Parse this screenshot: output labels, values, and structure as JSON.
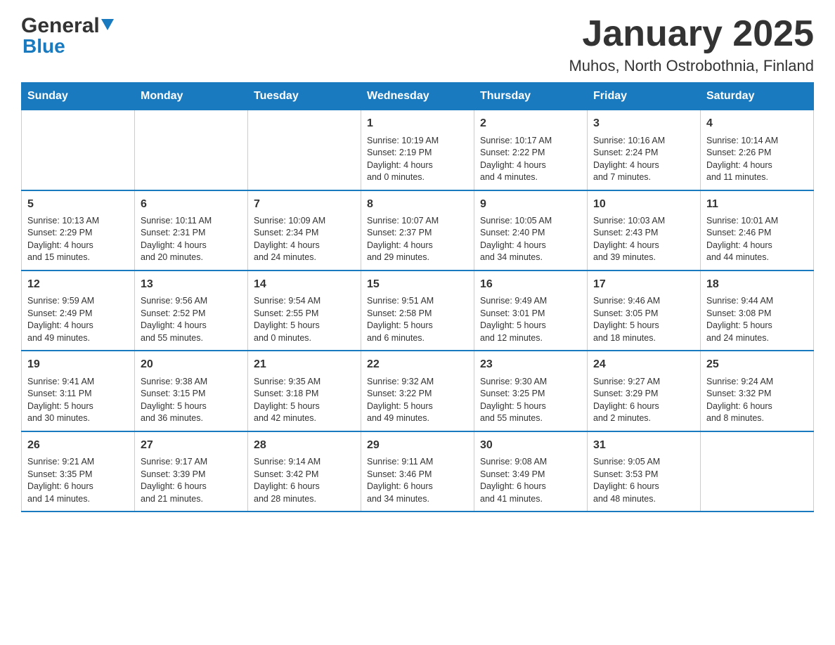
{
  "header": {
    "logo_text_general": "General",
    "logo_text_blue": "Blue",
    "main_title": "January 2025",
    "subtitle": "Muhos, North Ostrobothnia, Finland"
  },
  "calendar": {
    "days_of_week": [
      "Sunday",
      "Monday",
      "Tuesday",
      "Wednesday",
      "Thursday",
      "Friday",
      "Saturday"
    ],
    "weeks": [
      [
        {
          "day": "",
          "info": ""
        },
        {
          "day": "",
          "info": ""
        },
        {
          "day": "",
          "info": ""
        },
        {
          "day": "1",
          "info": "Sunrise: 10:19 AM\nSunset: 2:19 PM\nDaylight: 4 hours\nand 0 minutes."
        },
        {
          "day": "2",
          "info": "Sunrise: 10:17 AM\nSunset: 2:22 PM\nDaylight: 4 hours\nand 4 minutes."
        },
        {
          "day": "3",
          "info": "Sunrise: 10:16 AM\nSunset: 2:24 PM\nDaylight: 4 hours\nand 7 minutes."
        },
        {
          "day": "4",
          "info": "Sunrise: 10:14 AM\nSunset: 2:26 PM\nDaylight: 4 hours\nand 11 minutes."
        }
      ],
      [
        {
          "day": "5",
          "info": "Sunrise: 10:13 AM\nSunset: 2:29 PM\nDaylight: 4 hours\nand 15 minutes."
        },
        {
          "day": "6",
          "info": "Sunrise: 10:11 AM\nSunset: 2:31 PM\nDaylight: 4 hours\nand 20 minutes."
        },
        {
          "day": "7",
          "info": "Sunrise: 10:09 AM\nSunset: 2:34 PM\nDaylight: 4 hours\nand 24 minutes."
        },
        {
          "day": "8",
          "info": "Sunrise: 10:07 AM\nSunset: 2:37 PM\nDaylight: 4 hours\nand 29 minutes."
        },
        {
          "day": "9",
          "info": "Sunrise: 10:05 AM\nSunset: 2:40 PM\nDaylight: 4 hours\nand 34 minutes."
        },
        {
          "day": "10",
          "info": "Sunrise: 10:03 AM\nSunset: 2:43 PM\nDaylight: 4 hours\nand 39 minutes."
        },
        {
          "day": "11",
          "info": "Sunrise: 10:01 AM\nSunset: 2:46 PM\nDaylight: 4 hours\nand 44 minutes."
        }
      ],
      [
        {
          "day": "12",
          "info": "Sunrise: 9:59 AM\nSunset: 2:49 PM\nDaylight: 4 hours\nand 49 minutes."
        },
        {
          "day": "13",
          "info": "Sunrise: 9:56 AM\nSunset: 2:52 PM\nDaylight: 4 hours\nand 55 minutes."
        },
        {
          "day": "14",
          "info": "Sunrise: 9:54 AM\nSunset: 2:55 PM\nDaylight: 5 hours\nand 0 minutes."
        },
        {
          "day": "15",
          "info": "Sunrise: 9:51 AM\nSunset: 2:58 PM\nDaylight: 5 hours\nand 6 minutes."
        },
        {
          "day": "16",
          "info": "Sunrise: 9:49 AM\nSunset: 3:01 PM\nDaylight: 5 hours\nand 12 minutes."
        },
        {
          "day": "17",
          "info": "Sunrise: 9:46 AM\nSunset: 3:05 PM\nDaylight: 5 hours\nand 18 minutes."
        },
        {
          "day": "18",
          "info": "Sunrise: 9:44 AM\nSunset: 3:08 PM\nDaylight: 5 hours\nand 24 minutes."
        }
      ],
      [
        {
          "day": "19",
          "info": "Sunrise: 9:41 AM\nSunset: 3:11 PM\nDaylight: 5 hours\nand 30 minutes."
        },
        {
          "day": "20",
          "info": "Sunrise: 9:38 AM\nSunset: 3:15 PM\nDaylight: 5 hours\nand 36 minutes."
        },
        {
          "day": "21",
          "info": "Sunrise: 9:35 AM\nSunset: 3:18 PM\nDaylight: 5 hours\nand 42 minutes."
        },
        {
          "day": "22",
          "info": "Sunrise: 9:32 AM\nSunset: 3:22 PM\nDaylight: 5 hours\nand 49 minutes."
        },
        {
          "day": "23",
          "info": "Sunrise: 9:30 AM\nSunset: 3:25 PM\nDaylight: 5 hours\nand 55 minutes."
        },
        {
          "day": "24",
          "info": "Sunrise: 9:27 AM\nSunset: 3:29 PM\nDaylight: 6 hours\nand 2 minutes."
        },
        {
          "day": "25",
          "info": "Sunrise: 9:24 AM\nSunset: 3:32 PM\nDaylight: 6 hours\nand 8 minutes."
        }
      ],
      [
        {
          "day": "26",
          "info": "Sunrise: 9:21 AM\nSunset: 3:35 PM\nDaylight: 6 hours\nand 14 minutes."
        },
        {
          "day": "27",
          "info": "Sunrise: 9:17 AM\nSunset: 3:39 PM\nDaylight: 6 hours\nand 21 minutes."
        },
        {
          "day": "28",
          "info": "Sunrise: 9:14 AM\nSunset: 3:42 PM\nDaylight: 6 hours\nand 28 minutes."
        },
        {
          "day": "29",
          "info": "Sunrise: 9:11 AM\nSunset: 3:46 PM\nDaylight: 6 hours\nand 34 minutes."
        },
        {
          "day": "30",
          "info": "Sunrise: 9:08 AM\nSunset: 3:49 PM\nDaylight: 6 hours\nand 41 minutes."
        },
        {
          "day": "31",
          "info": "Sunrise: 9:05 AM\nSunset: 3:53 PM\nDaylight: 6 hours\nand 48 minutes."
        },
        {
          "day": "",
          "info": ""
        }
      ]
    ]
  }
}
